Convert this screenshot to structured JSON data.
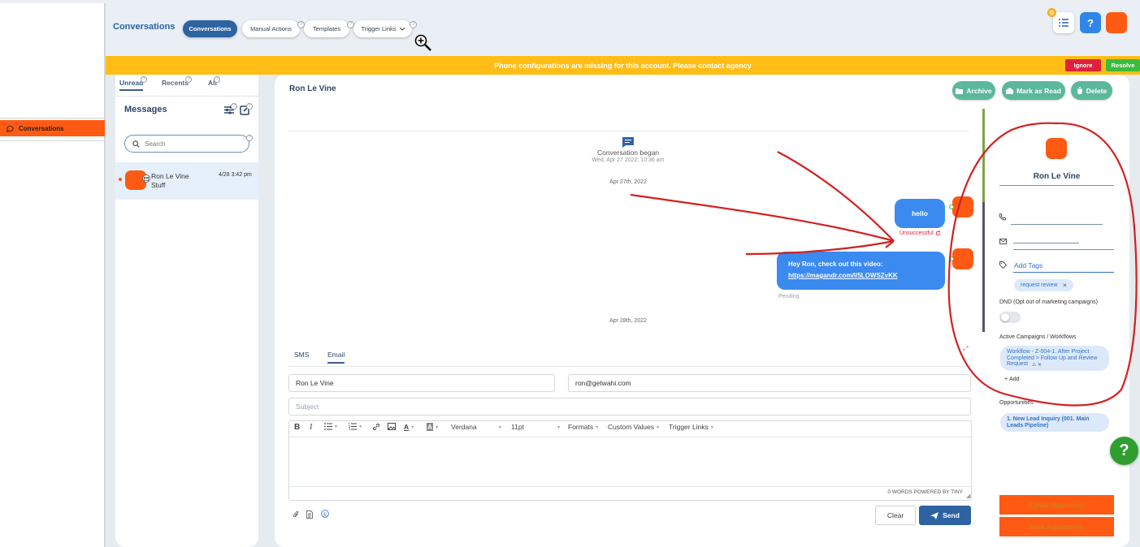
{
  "sidebar": {
    "item_label": "Conversations"
  },
  "header": {
    "title": "Conversations",
    "tabs": [
      {
        "label": "Conversations"
      },
      {
        "label": "Manual Actions"
      },
      {
        "label": "Templates"
      },
      {
        "label": "Trigger Links"
      }
    ],
    "help_label": "?"
  },
  "banner": {
    "text": "Phone configurations are missing for this account. Please contact agency",
    "ignore_label": "Ignore",
    "resolve_label": "Resolve"
  },
  "list": {
    "tabs": [
      "Unread",
      "Recents",
      "All"
    ],
    "heading": "Messages",
    "search_placeholder": "Search",
    "items": [
      {
        "name": "Ron Le Vine",
        "preview": "Stuff",
        "time": "4/28 3:42 pm"
      }
    ]
  },
  "conversation": {
    "contact_name": "Ron Le Vine",
    "actions": [
      "Archive",
      "Mark as Read",
      "Delete"
    ],
    "began_label": "Conversation began",
    "began_date": "Wed, Apr 27 2022, 10:36 am",
    "date_sep_1": "Apr 27th, 2022",
    "date_sep_2": "Apr 28th, 2022",
    "messages": [
      {
        "text": "hello",
        "status": "Unsuccessful"
      },
      {
        "text": "Hey Ron, check out this video:",
        "link": "https://magandr.com/l/5LOWSZvKK",
        "status": "Pending"
      }
    ]
  },
  "composer": {
    "tabs": [
      "SMS",
      "Email"
    ],
    "from_name": "Ron Le Vine",
    "to_email": "ron@getwahi.com",
    "subject_placeholder": "Subject",
    "font": "Verdana",
    "size": "11pt",
    "formats_label": "Formats",
    "custom_values_label": "Custom Values",
    "trigger_links_label": "Trigger Links",
    "footer": "0 WORDS POWERED BY TINY",
    "clear_label": "Clear",
    "send_label": "Send"
  },
  "contact": {
    "name": "Ron Le Vine",
    "add_tags_label": "Add Tags",
    "tag": "request review",
    "dnd_label": "DND (Opt out of marketing campaigns)",
    "campaigns_label": "Active Campaigns / Workflows",
    "workflow": "Workflow - Z-004-1. After Project Completed > Follow Up and Review Request",
    "add_label": "Add",
    "opportunities_label": "Opportunities",
    "opportunity": "1. New Lead Inquiry (001. Main Leads Pipeline)",
    "create_opportunity_label": "Create Opportunity",
    "book_appointment_label": "Book Appointment"
  },
  "colors": {
    "brand_blue": "#2e63a2",
    "accent_orange": "#ff5a13",
    "banner_yellow": "#ffbd16",
    "green": "#5bb89a",
    "annotation_red": "#d42020"
  }
}
